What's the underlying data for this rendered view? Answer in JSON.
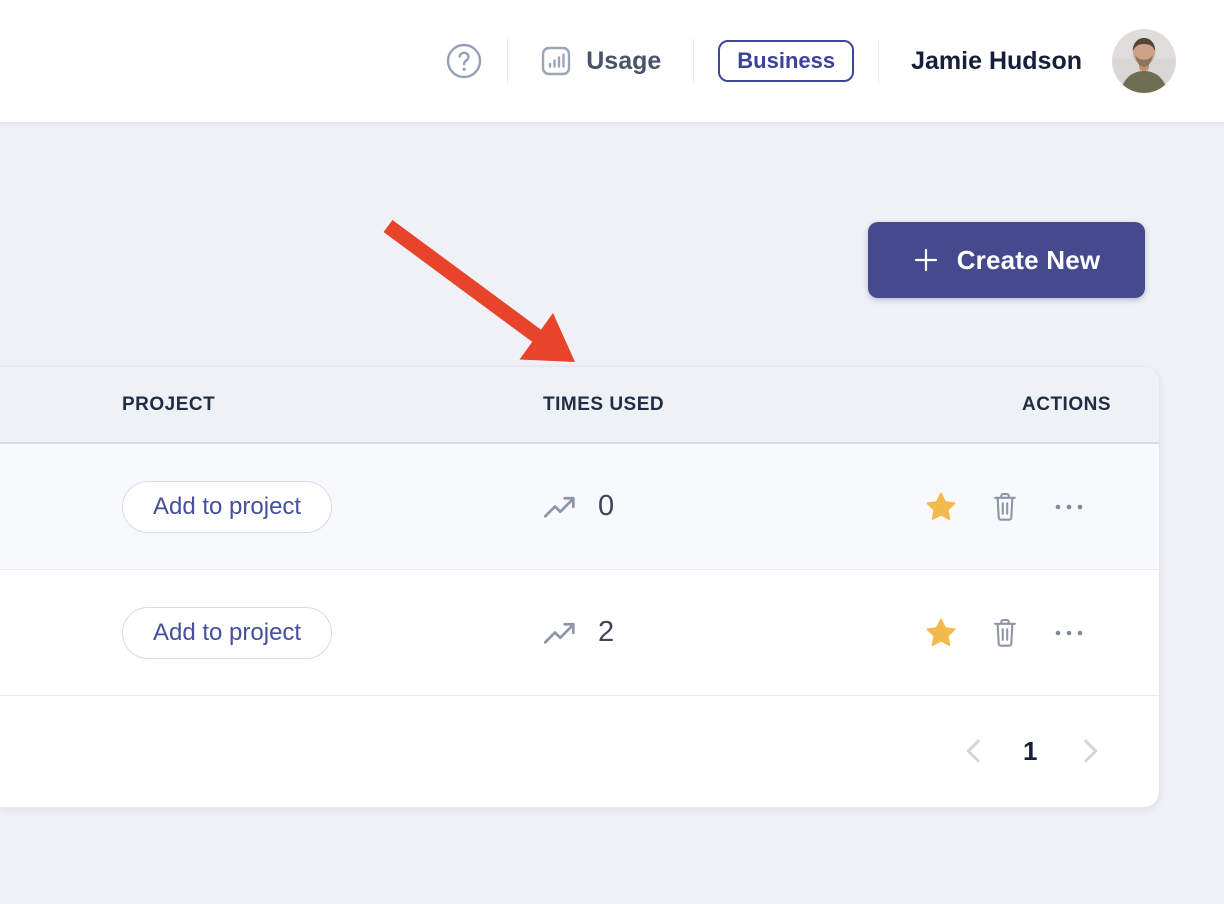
{
  "header": {
    "usage_label": "Usage",
    "plan_badge_label": "Business",
    "user_name": "Jamie Hudson"
  },
  "actions_bar": {
    "create_new_label": "Create New"
  },
  "table": {
    "columns": [
      "PROJECT",
      "TIMES USED",
      "ACTIONS"
    ],
    "rows": [
      {
        "project_action_label": "Add to project",
        "times_used": "0"
      },
      {
        "project_action_label": "Add to project",
        "times_used": "2"
      }
    ]
  },
  "pagination": {
    "current_page": "1"
  },
  "icons": {
    "help": "circle-question-mark",
    "usage": "bar-chart-square",
    "plus": "+",
    "trend": "trending-up-arrow",
    "favorite": "star-filled",
    "delete": "trash-outline",
    "more": "ellipsis-horizontal",
    "prev_page": "chevron-left",
    "next_page": "chevron-right",
    "annotation": "red-arrow-pointing-down-right",
    "avatar": "user-photo"
  },
  "colors": {
    "page_bg": "#eff1f6",
    "accent_indigo": "#3f479b",
    "create_button_bg": "#454a8f",
    "star_yellow": "#f4b94c",
    "arrow_red": "#e8432b",
    "icon_gray": "#8d96a8",
    "table_header_bg": "#eef1f6",
    "row_highlight_bg": "#f7f9fd",
    "text_dark": "#161f38"
  }
}
